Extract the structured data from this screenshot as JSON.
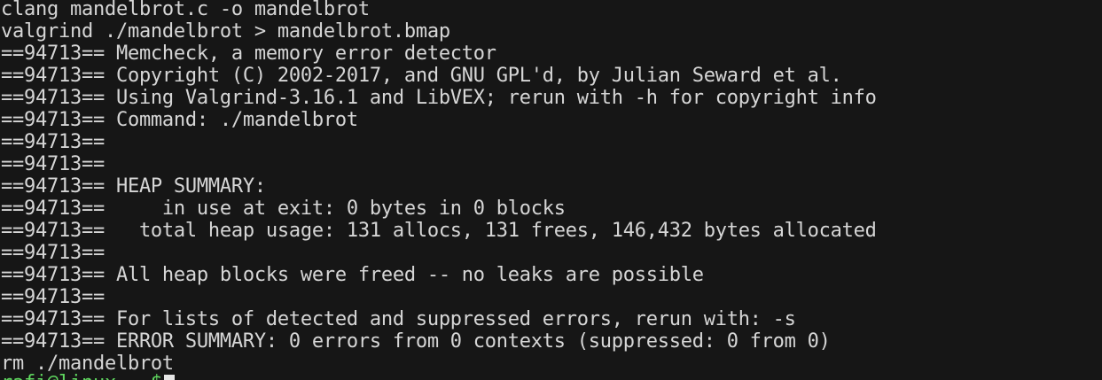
{
  "terminal": {
    "lines": [
      "clang mandelbrot.c -o mandelbrot",
      "valgrind ./mandelbrot > mandelbrot.bmap",
      "==94713== Memcheck, a memory error detector",
      "==94713== Copyright (C) 2002-2017, and GNU GPL'd, by Julian Seward et al.",
      "==94713== Using Valgrind-3.16.1 and LibVEX; rerun with -h for copyright info",
      "==94713== Command: ./mandelbrot",
      "==94713==",
      "==94713==",
      "==94713== HEAP SUMMARY:",
      "==94713==     in use at exit: 0 bytes in 0 blocks",
      "==94713==   total heap usage: 131 allocs, 131 frees, 146,432 bytes allocated",
      "==94713==",
      "==94713== All heap blocks were freed -- no leaks are possible",
      "==94713==",
      "==94713== For lists of detected and suppressed errors, rerun with: -s",
      "==94713== ERROR SUMMARY: 0 errors from 0 contexts (suppressed: 0 from 0)",
      "rm ./mandelbrot"
    ],
    "prompt": "rafi@linux ~ $",
    "colors": {
      "background": "#161616",
      "foreground": "#d6d6d6",
      "prompt": "#5fd75f",
      "cursor": "#e6e6e6"
    }
  }
}
